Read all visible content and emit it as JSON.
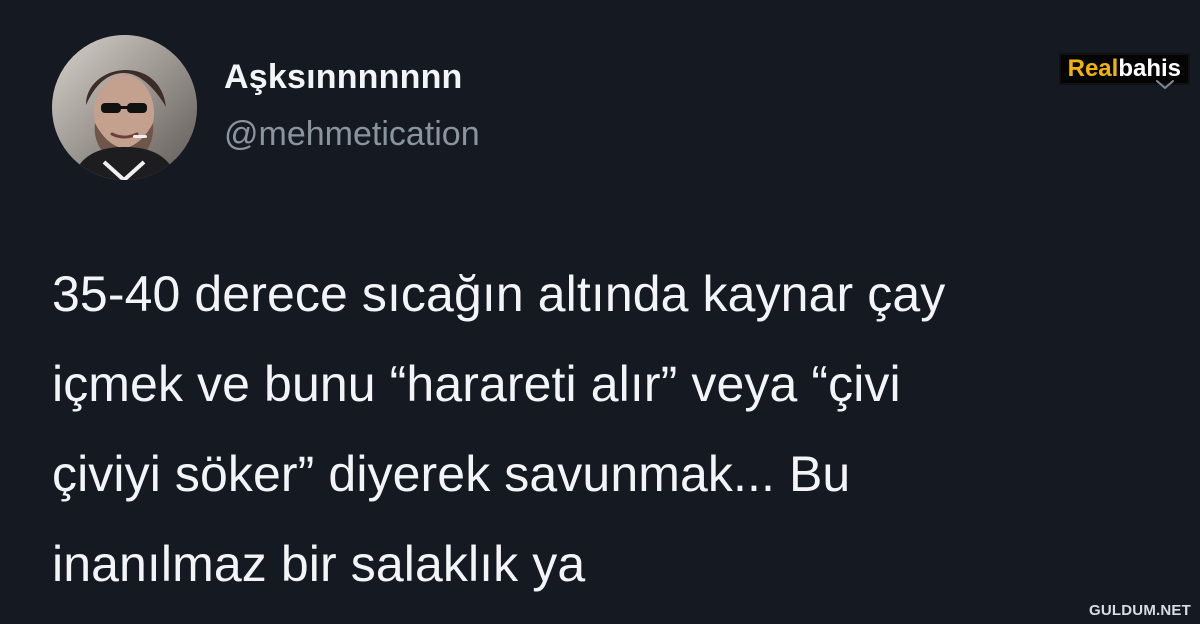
{
  "tweet": {
    "author": {
      "display_name": "Aşksınnnnnnn",
      "handle": "@mehmetication",
      "avatar_icon": "person-avatar-icon"
    },
    "text": "35-40 derece sıcağın altında kaynar çay\niçmek ve bunu “harareti alır” veya “çivi\nçiviyi söker” diyerek savunmak... Bu\ninanılmaz bir salaklık ya"
  },
  "brand": {
    "real": "Real",
    "bahis": "bahis",
    "accent": "#f0b400"
  },
  "watermark": {
    "text": "GULDUM.NET"
  },
  "colors": {
    "background": "#151a22",
    "text": "#f2f4f7",
    "muted": "#8a949f"
  }
}
